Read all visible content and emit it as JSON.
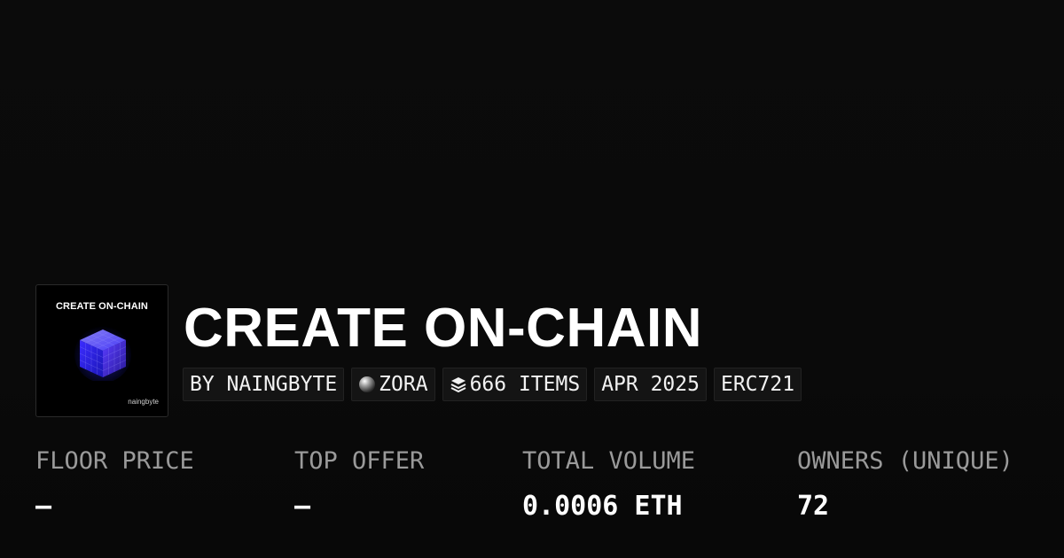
{
  "collection": {
    "thumbnail": {
      "title": "CREATE ON-CHAIN",
      "author": "naingbyte",
      "accent_color": "#3b3bff"
    },
    "title": "CREATE ON-CHAIN",
    "tags": [
      {
        "label": "BY NAINGBYTE",
        "icon": null
      },
      {
        "label": "ZORA",
        "icon": "zora-sphere-icon"
      },
      {
        "label": "666 ITEMS",
        "icon": "layers-icon"
      },
      {
        "label": "APR 2025",
        "icon": null
      },
      {
        "label": "ERC721",
        "icon": null
      }
    ]
  },
  "stats": [
    {
      "label": "FLOOR PRICE",
      "value": "—"
    },
    {
      "label": "TOP OFFER",
      "value": "—"
    },
    {
      "label": "TOTAL VOLUME",
      "value": "0.0006 ETH"
    },
    {
      "label": "OWNERS (UNIQUE)",
      "value": "72"
    }
  ],
  "colors": {
    "background": "#0a0a0a",
    "text": "#ffffff",
    "muted": "#9a9a9a",
    "tag_bg": "#141414"
  }
}
